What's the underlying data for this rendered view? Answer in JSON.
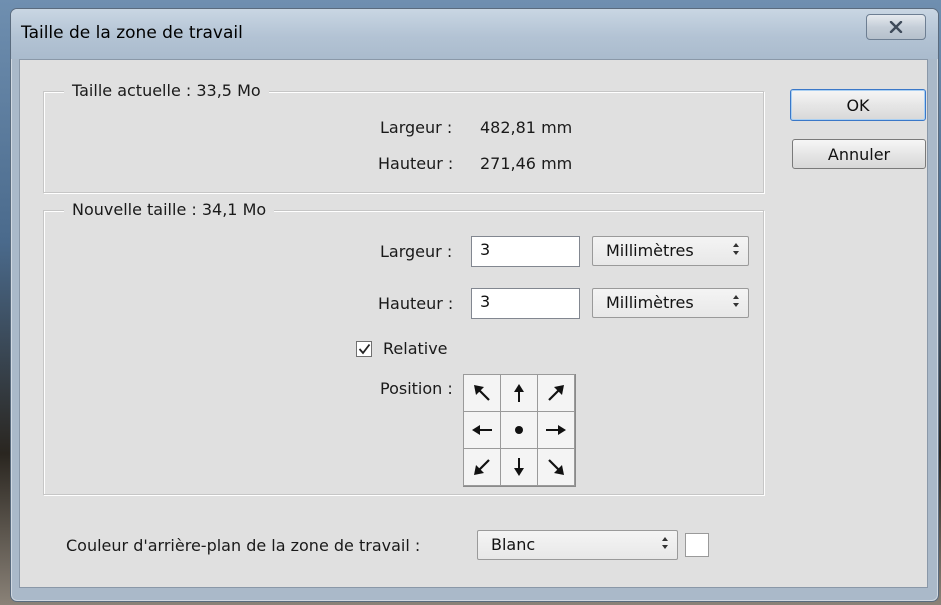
{
  "window": {
    "title": "Taille de la zone de travail"
  },
  "current_size": {
    "legend": "Taille actuelle : 33,5 Mo",
    "width_label": "Largeur :",
    "width_value": "482,81 mm",
    "height_label": "Hauteur :",
    "height_value": "271,46 mm"
  },
  "new_size": {
    "legend": "Nouvelle taille : 34,1 Mo",
    "width_label": "Largeur :",
    "width_value": "3",
    "width_unit": "Millimètres",
    "height_label": "Hauteur :",
    "height_value": "3",
    "height_unit": "Millimètres",
    "relative_label": "Relative",
    "relative_checked": true,
    "position_label": "Position :",
    "anchor": "center"
  },
  "buttons": {
    "ok": "OK",
    "cancel": "Annuler"
  },
  "background": {
    "label": "Couleur d'arrière-plan de la zone de travail :",
    "value": "Blanc",
    "swatch_color": "#ffffff"
  },
  "icons": {
    "close": "close-icon",
    "anchor_arrows": [
      "arrow-up-left-icon",
      "arrow-up-icon",
      "arrow-up-right-icon",
      "arrow-left-icon",
      "anchor-center-dot-icon",
      "arrow-right-icon",
      "arrow-down-left-icon",
      "arrow-down-icon",
      "arrow-down-right-icon"
    ]
  }
}
